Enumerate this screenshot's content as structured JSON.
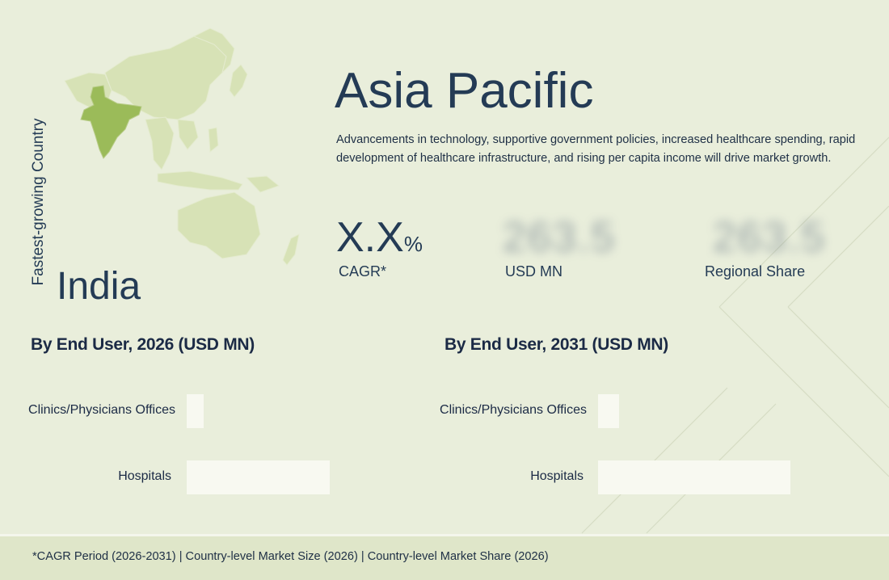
{
  "region": {
    "title": "Asia Pacific",
    "description": "Advancements in technology, supportive government policies, increased healthcare spending, rapid development of healthcare infrastructure, and rising per capita income will drive market growth."
  },
  "fastest_country": {
    "label": "Fastest-growing Country",
    "name": "India"
  },
  "stats": [
    {
      "value": "X.X",
      "suffix": "%",
      "label": "CAGR*",
      "blurred": false
    },
    {
      "value": "263.5",
      "suffix": "",
      "label": "USD MN",
      "blurred": true
    },
    {
      "value": "263.5",
      "suffix": "",
      "label": "Regional Share",
      "blurred": true
    }
  ],
  "chart_data": [
    {
      "type": "bar",
      "title": "By End User, 2026 (USD MN)",
      "categories": [
        "Clinics/Physicians Offices",
        "Hospitals"
      ],
      "values": [
        12,
        100
      ],
      "orientation": "horizontal"
    },
    {
      "type": "bar",
      "title": "By End User, 2031 (USD MN)",
      "categories": [
        "Clinics/Physicians Offices",
        "Hospitals"
      ],
      "values": [
        11,
        100
      ],
      "orientation": "horizontal"
    }
  ],
  "footer": {
    "text": "*CAGR Period (2026-2031)  |  Country-level Market Size (2026)  |  Country-level Market Share (2026)"
  },
  "colors": {
    "background": "#e9eedb",
    "map_land": "#d7e2b6",
    "highlight_country": "#9bbb59",
    "bar": "#f8f9f1",
    "text": "#243b55"
  }
}
